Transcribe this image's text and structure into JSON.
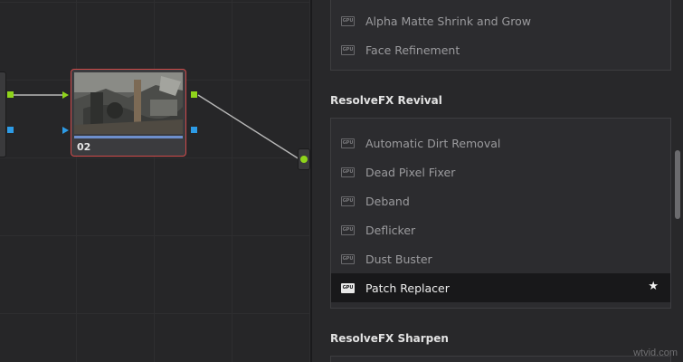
{
  "node_editor": {
    "node": {
      "label": "02"
    }
  },
  "effects_library": {
    "groups": [
      {
        "title": "",
        "items": [
          {
            "label": "Alpha Matte Shrink and Grow",
            "badge": "GPU"
          },
          {
            "label": "Face Refinement",
            "badge": "GPU"
          }
        ]
      },
      {
        "title": "ResolveFX Revival",
        "items": [
          {
            "label": "Automatic Dirt Removal",
            "badge": "GPU"
          },
          {
            "label": "Dead Pixel Fixer",
            "badge": "GPU"
          },
          {
            "label": "Deband",
            "badge": "GPU"
          },
          {
            "label": "Deflicker",
            "badge": "GPU"
          },
          {
            "label": "Dust Buster",
            "badge": "GPU"
          },
          {
            "label": "Patch Replacer",
            "badge": "GPU",
            "selected": true,
            "favorite_icon": "star-icon"
          }
        ]
      },
      {
        "title": "ResolveFX Sharpen",
        "items": []
      }
    ]
  },
  "watermark": "wtvid.com",
  "colors": {
    "node_border": "#cf4a4a",
    "port_green": "#8fd41b",
    "port_blue": "#2d9be6",
    "selected_row": "#18181a"
  }
}
